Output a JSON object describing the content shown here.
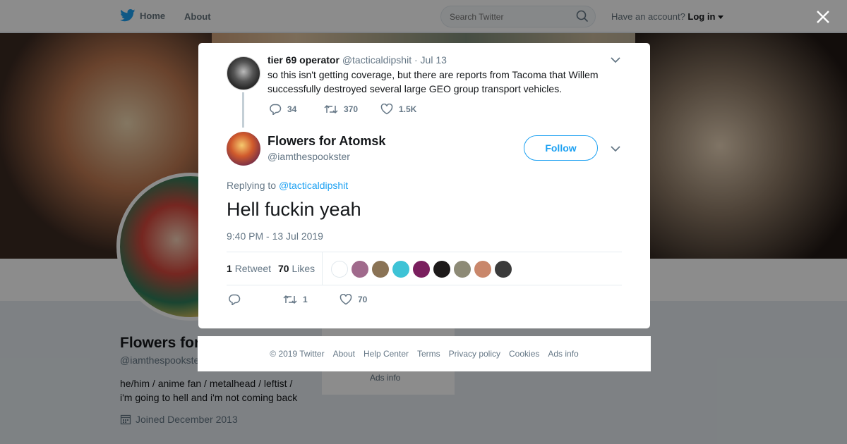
{
  "nav": {
    "home": "Home",
    "about": "About",
    "search_placeholder": "Search Twitter",
    "account_prefix": "Have an account?",
    "login": "Log in"
  },
  "profile": {
    "name": "Flowers for Atomsk",
    "handle": "@iamthespookster",
    "bio_line1": "he/him / anime fan / metalhead / leftist /",
    "bio_line2": "i'm going to hell and i'm not coming back",
    "joined": "Joined December 2013",
    "side_ads_info": "Ads info"
  },
  "parent_tweet": {
    "name": "tier 69 operator",
    "handle": "@tacticaldipshit",
    "date": "Jul 13",
    "separator": "·",
    "text": "so this isn't getting coverage, but there are reports from Tacoma that Willem successfully destroyed several large GEO group transport vehicles.",
    "replies": "34",
    "retweets": "370",
    "likes": "1.5K"
  },
  "tweet": {
    "name": "Flowers for Atomsk",
    "handle": "@iamthespookster",
    "follow_label": "Follow",
    "replying_prefix": "Replying to",
    "replying_to": "@tacticaldipshit",
    "text": "Hell fuckin yeah",
    "timestamp": "9:40 PM - 13 Jul 2019",
    "retweet_count": "1",
    "retweet_label": "Retweet",
    "like_count": "70",
    "like_label": "Likes",
    "action_retweets": "1",
    "action_likes": "70"
  },
  "footer": {
    "copyright": "© 2019 Twitter",
    "about": "About",
    "help": "Help Center",
    "terms": "Terms",
    "privacy": "Privacy policy",
    "cookies": "Cookies",
    "ads": "Ads info"
  },
  "colors": {
    "accent": "#1da1f2",
    "text_primary": "#14171a",
    "text_secondary": "#657786",
    "like_red": "#e0245e"
  },
  "icons": [
    "twitter-bird-icon",
    "search-icon",
    "caret-down-icon",
    "close-icon",
    "chevron-down-icon",
    "reply-icon",
    "retweet-icon",
    "heart-icon",
    "calendar-icon"
  ]
}
